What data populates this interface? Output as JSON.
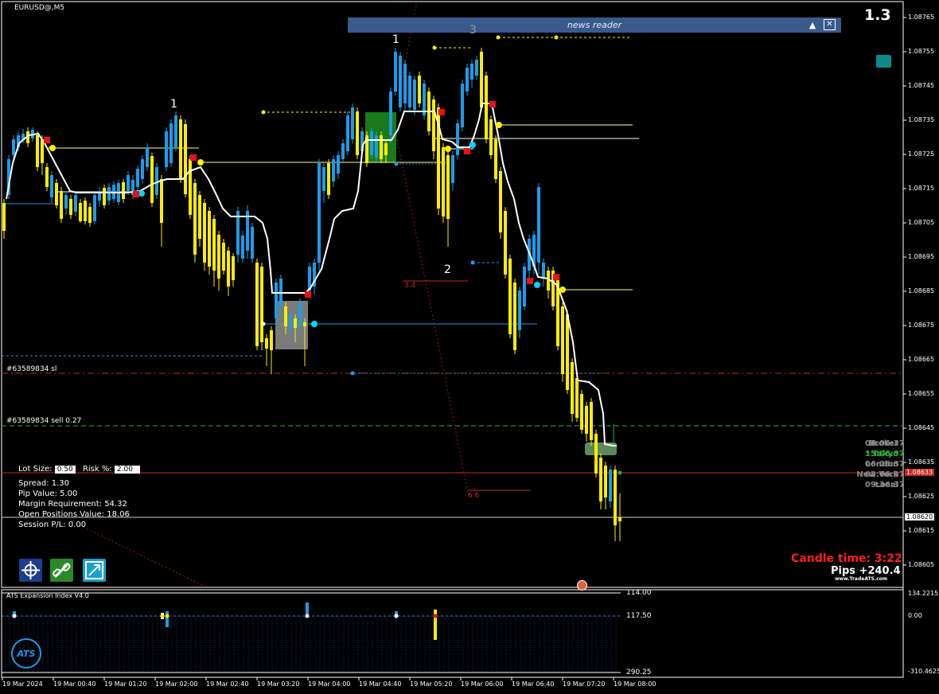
{
  "symbol_title": "EURUSD@,M5",
  "spread_top": "1.3",
  "news_reader": {
    "title": "news reader",
    "collapse_icon": "caret-up-icon",
    "close_icon": "close-icon"
  },
  "wave_labels": {
    "w1_left": "1",
    "w1_mid": "1",
    "w2": "2",
    "w3": "3"
  },
  "target_labels": {
    "t1": "3.4",
    "t2": "6.6"
  },
  "order_lines": {
    "sl_label": "#63589834 sl",
    "sell_label": "#63589834 sell 0.27"
  },
  "price_axis": {
    "ticks": [
      "1.08765",
      "1.08755",
      "1.08745",
      "1.08735",
      "1.08725",
      "1.08715",
      "1.08705",
      "1.08695",
      "1.08685",
      "1.08675",
      "1.08665",
      "1.08655",
      "1.08645",
      "1.08635",
      "1.08625",
      "1.08615",
      "1.08605"
    ],
    "bid_label": "1.08620",
    "ask_label": "1.08633"
  },
  "lot_panel": {
    "lot_size_label": "Lot Size:",
    "lot_size_value": "0.50",
    "risk_label": "Risk %:",
    "risk_value": "2.00",
    "spread": "Spread: 1.30",
    "pip_value": "Pip Value: 5.00",
    "margin": "Margin Requirement: 54.32",
    "open_positions": "Open Positions Value: 18.06",
    "session_pl": "Session P/L: 0.00"
  },
  "sessions": [
    {
      "name": "Broker",
      "time": "08:06:37",
      "color": "#8a8a8a"
    },
    {
      "name": "* Tokyo",
      "time": "15:06:37",
      "color": "#2eaf3a"
    },
    {
      "name": "London",
      "time": "06:06:37",
      "color": "#8a8a8a"
    },
    {
      "name": "New York",
      "time": "02:06:37",
      "color": "#8a8a8a"
    },
    {
      "name": "Local",
      "time": "09:36:37",
      "color": "#8a8a8a"
    }
  ],
  "candle_time": "Candle time:  3:22",
  "pips": "Pips +240.4",
  "brand_url": "www.TradeATS.com",
  "tool_buttons": [
    {
      "name": "crosshair-target-icon",
      "color": "#1e3d8f"
    },
    {
      "name": "chain-link-icon",
      "color": "#2a8a2a"
    },
    {
      "name": "expand-chart-icon",
      "color": "#1aa0d0"
    }
  ],
  "indicator": {
    "title": "ATS Expansion Index V4.0",
    "level_top": "114.00",
    "level_mid": "117.50",
    "level_bottom": "290.25",
    "axis_top": "134.2215",
    "axis_zero": "0.00",
    "axis_bottom": "-310.4625",
    "logo_text": "ATS"
  },
  "time_axis": [
    "19 Mar 2024",
    "19 Mar 00:40",
    "19 Mar 01:20",
    "19 Mar 02:00",
    "19 Mar 02:40",
    "19 Mar 03:20",
    "19 Mar 04:00",
    "19 Mar 04:40",
    "19 Mar 05:20",
    "19 Mar 06:00",
    "19 Mar 06:40",
    "19 Mar 07:20",
    "19 Mar 08:00"
  ],
  "colors": {
    "bull": "#1e9be8",
    "bear": "#ffec00",
    "stepline": "#ffffff",
    "sl_line": "#c8281e",
    "sell_line": "#2eaf3a",
    "ask_line": "#c8281e"
  }
}
